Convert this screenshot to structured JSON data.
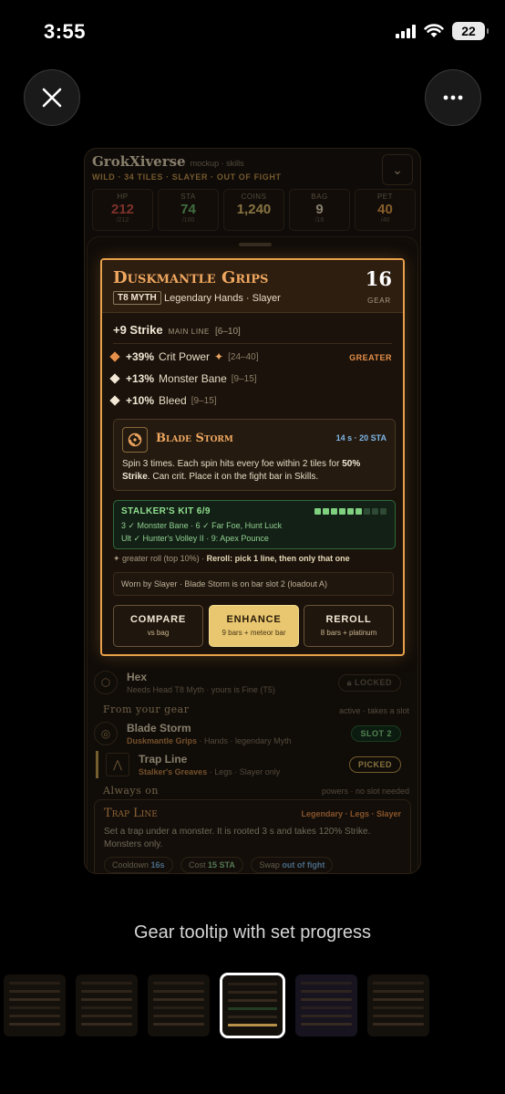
{
  "status_bar": {
    "time": "3:55",
    "battery": "22"
  },
  "mockup": {
    "title": "GrokXiverse",
    "title_note": "mockup · skills",
    "subtitle": "WILD · 34 TILES · SLAYER · OUT OF FIGHT",
    "stats": [
      {
        "label": "HP",
        "value": "212",
        "max": "/212",
        "color": "#d9564a"
      },
      {
        "label": "STA",
        "value": "74",
        "max": "/100",
        "color": "#6fbf6f"
      },
      {
        "label": "COINS",
        "value": "1,240",
        "max": "",
        "color": "#e8c770"
      },
      {
        "label": "BAG",
        "value": "9",
        "max": "/16",
        "color": "#e8d9b8"
      },
      {
        "label": "PET",
        "value": "40",
        "max": "/40",
        "color": "#e8a04a"
      }
    ],
    "hex": {
      "name": "Hex",
      "desc": "Needs Head T8 Myth · yours is Fine (T5)",
      "badge": "LOCKED"
    },
    "section_gear": {
      "title": "From your gear",
      "note": "active · takes a slot"
    },
    "blade_row": {
      "name": "Blade Storm",
      "source": "Duskmantle Grips",
      "desc": " · Hands · legendary Myth",
      "badge": "SLOT 2"
    },
    "trap_row": {
      "name": "Trap Line",
      "source": "Stalker's Greaves",
      "desc": " · Legs · Slayer only",
      "badge": "PICKED"
    },
    "section_always": {
      "title": "Always on",
      "note": "powers · no slot needed"
    },
    "trap_card": {
      "name": "Trap Line",
      "tags": "Legendary · Legs · Slayer",
      "desc": "Set a trap under a monster. It is rooted 3 s and takes 120% Strike. Monsters only.",
      "chips": [
        {
          "label": "Cooldown ",
          "value": "16s",
          "color": "#7fb8e8"
        },
        {
          "label": "Cost ",
          "value": "15 STA",
          "color": "#8fd08f"
        },
        {
          "label": "Swap ",
          "value": "out of fight",
          "color": "#7fb8e8"
        }
      ]
    }
  },
  "tooltip": {
    "name": "Duskmantle Grips",
    "tier": "T8 MYTH",
    "kind": "Legendary Hands · Slayer",
    "gear_score": "16",
    "gear_score_label": "GEAR",
    "main_line": {
      "value": "+9 Strike",
      "tag": "MAIN LINE",
      "range": "[6–10]"
    },
    "affixes": [
      {
        "value": "+39%",
        "stat": "Crit Power",
        "range": "[24–40]",
        "star": "✦",
        "color": "#e8904a"
      },
      {
        "value": "+13%",
        "stat": "Monster Bane",
        "range": "[9–15]",
        "star": "",
        "color": "#f2e8d5"
      },
      {
        "value": "+10%",
        "stat": "Bleed",
        "range": "[9–15]",
        "star": "",
        "color": "#f2e8d5"
      }
    ],
    "greater_label": "GREATER",
    "skill": {
      "name": "Blade Storm",
      "meta": "14 s · 20 STA",
      "desc_a": "Spin 3 times. Each spin hits every foe within 2 tiles for ",
      "desc_b": "50% Strike",
      "desc_c": ". Can crit. Place it on the fight bar in Skills."
    },
    "set": {
      "title": "STALKER'S KIT 6/9",
      "pieces_total": 9,
      "pieces_have": 6,
      "line1": "3 ✓ Monster Bane · 6 ✓ Far Foe, Hunt Luck",
      "line2": "Ult ✓ Hunter's Volley II · 9: Apex Pounce"
    },
    "roll_a": "✦ greater roll (top 10%) · ",
    "roll_b": "Reroll: pick 1 line, then only that one",
    "worn": "Worn by Slayer · Blade Storm is on bar slot 2 (loadout A)",
    "buttons": [
      {
        "label": "COMPARE",
        "sub": "vs bag",
        "style": "dark"
      },
      {
        "label": "ENHANCE",
        "sub": "9 bars + meteor bar",
        "style": "gold"
      },
      {
        "label": "REROLL",
        "sub": "8 bars + platinum",
        "style": "dark"
      }
    ]
  },
  "caption": "Gear tooltip with set progress",
  "thumbnails": {
    "count": 6,
    "selected_index": 3
  }
}
